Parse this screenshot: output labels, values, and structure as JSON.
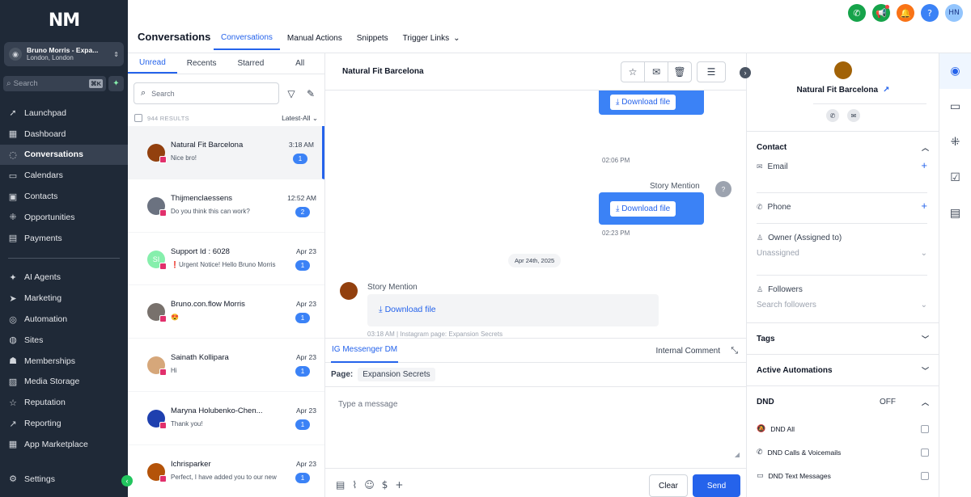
{
  "sidebar": {
    "logo": "NM",
    "location": {
      "name": "Bruno Morris - Expa...",
      "sub": "London, London"
    },
    "search": {
      "placeholder": "Search",
      "shortcut": "⌘K"
    },
    "items": [
      {
        "label": "Launchpad",
        "icon": "rocket-icon",
        "glyph": "➚"
      },
      {
        "label": "Dashboard",
        "icon": "dashboard-icon",
        "glyph": "▦"
      },
      {
        "label": "Conversations",
        "icon": "chat-icon",
        "glyph": "◌",
        "active": true
      },
      {
        "label": "Calendars",
        "icon": "calendar-icon",
        "glyph": "▭"
      },
      {
        "label": "Contacts",
        "icon": "contacts-icon",
        "glyph": "▣"
      },
      {
        "label": "Opportunities",
        "icon": "opportunities-icon",
        "glyph": "⁜"
      },
      {
        "label": "Payments",
        "icon": "payments-icon",
        "glyph": "▤"
      }
    ],
    "items2": [
      {
        "label": "AI Agents",
        "icon": "ai-icon",
        "glyph": "✦"
      },
      {
        "label": "Marketing",
        "icon": "send-icon",
        "glyph": "➤"
      },
      {
        "label": "Automation",
        "icon": "automation-icon",
        "glyph": "◎"
      },
      {
        "label": "Sites",
        "icon": "globe-icon",
        "glyph": "◍"
      },
      {
        "label": "Memberships",
        "icon": "memberships-icon",
        "glyph": "☗"
      },
      {
        "label": "Media Storage",
        "icon": "media-icon",
        "glyph": "▨"
      },
      {
        "label": "Reputation",
        "icon": "star-icon",
        "glyph": "☆"
      },
      {
        "label": "Reporting",
        "icon": "reporting-icon",
        "glyph": "↗"
      },
      {
        "label": "App Marketplace",
        "icon": "apps-icon",
        "glyph": "▦"
      }
    ],
    "settings": "Settings"
  },
  "header": {
    "title": "Conversations",
    "tabs": [
      {
        "label": "Conversations",
        "active": true
      },
      {
        "label": "Manual Actions"
      },
      {
        "label": "Snippets"
      },
      {
        "label": "Trigger Links",
        "dropdown": true
      }
    ],
    "icons": [
      {
        "name": "phone-icon",
        "glyph": "✆",
        "color": "#16a34a"
      },
      {
        "name": "megaphone-icon",
        "glyph": "📢",
        "color": "#16a34a",
        "dot": true
      },
      {
        "name": "bell-icon",
        "glyph": "🔔",
        "color": "#f97316"
      },
      {
        "name": "help-icon",
        "glyph": "?",
        "color": "#3b82f6"
      },
      {
        "name": "user-avatar-icon",
        "glyph": "HN",
        "color": "#93c5fd"
      }
    ]
  },
  "list": {
    "filter_tabs": [
      {
        "label": "Unread",
        "active": true
      },
      {
        "label": "Recents"
      },
      {
        "label": "Starred"
      },
      {
        "label": "All"
      }
    ],
    "search_placeholder": "Search",
    "result_count": "944 RESULTS",
    "sort": "Latest-All",
    "conversations": [
      {
        "name": "Natural Fit Barcelona",
        "msg": "Nice bro!",
        "time": "3:18 AM",
        "badge": "1",
        "selected": true,
        "color": "#92400e",
        "initials": ""
      },
      {
        "name": "Thijmenclaessens",
        "msg": "Do you think this can work?",
        "time": "12:52 AM",
        "badge": "2",
        "color": "#6b7280",
        "initials": ""
      },
      {
        "name": "Support Id : 6028",
        "msg": "❗Urgent Notice! Hello Bruno Morris",
        "time": "Apr 23",
        "badge": "1",
        "color": "#86efac",
        "initials": "SI"
      },
      {
        "name": "Bruno.con.flow Morris",
        "msg": "😍",
        "time": "Apr 23",
        "badge": "1",
        "color": "#78716c",
        "initials": ""
      },
      {
        "name": "Sainath Kollipara",
        "msg": "Hi",
        "time": "Apr 23",
        "badge": "1",
        "color": "#d6a77a",
        "initials": ""
      },
      {
        "name": "Maryna Holubenko-Chen...",
        "msg": "Thank you!",
        "time": "Apr 23",
        "badge": "1",
        "color": "#1e40af",
        "initials": ""
      },
      {
        "name": "Ichrisparker",
        "msg": "Perfect, I have added you to our new",
        "time": "Apr 23",
        "badge": "1",
        "color": "#b45309",
        "initials": ""
      }
    ]
  },
  "chat": {
    "contact_name": "Natural Fit Barcelona",
    "header_buttons": [
      "star-icon",
      "mark-read-icon",
      "trash-icon",
      "filter-icon"
    ],
    "download_label": "Download file",
    "story_mention": "Story Mention",
    "times": [
      "02:06 PM",
      "02:23 PM"
    ],
    "date_divider": "Apr 24th, 2025",
    "incoming_meta": "03:18 AM | Instagram page: Expansion Secrets",
    "compose": {
      "tab": "IG Messenger DM",
      "internal": "Internal Comment",
      "page_label": "Page:",
      "page_value": "Expansion Secrets",
      "placeholder": "Type a message",
      "clear": "Clear",
      "send": "Send"
    }
  },
  "contact": {
    "name": "Natural Fit Barcelona",
    "section_contact": "Contact",
    "email": "Email",
    "phone": "Phone",
    "owner_label": "Owner (Assigned to)",
    "owner_value": "Unassigned",
    "followers_label": "Followers",
    "followers_placeholder": "Search followers",
    "tags": "Tags",
    "active_automations": "Active Automations",
    "dnd": "DND",
    "dnd_state": "OFF",
    "dnd_all": "DND All",
    "dnd_calls": "DND Calls & Voicemails",
    "dnd_text": "DND Text Messages"
  },
  "colors": {
    "accent": "#2563eb",
    "sidebar": "#1f2937",
    "instagram": "#e1306c"
  }
}
